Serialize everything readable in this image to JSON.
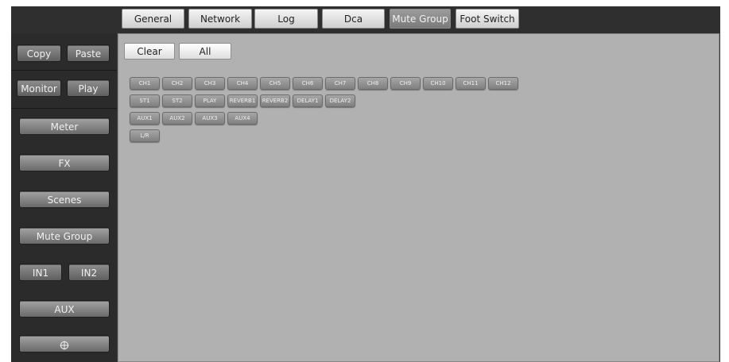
{
  "tabs": [
    {
      "label": "General",
      "active": false
    },
    {
      "label": "Network",
      "active": false
    },
    {
      "label": "Log",
      "active": false
    },
    {
      "label": "Dca",
      "active": false
    },
    {
      "label": "Mute Group",
      "active": true
    },
    {
      "label": "Foot Switch",
      "active": false
    }
  ],
  "sidebar": {
    "copy": "Copy",
    "paste": "Paste",
    "monitor": "Monitor",
    "play": "Play",
    "meter": "Meter",
    "fx": "FX",
    "scenes": "Scenes",
    "mute_group": "Mute Group",
    "in1": "IN1",
    "in2": "IN2",
    "aux": "AUX",
    "bottom_icon": "target-icon"
  },
  "toolbar": {
    "clear": "Clear",
    "all": "All"
  },
  "channels": {
    "row1": [
      "CH1",
      "CH2",
      "CH3",
      "CH4",
      "CH5",
      "CH6",
      "CH7",
      "CH8",
      "CH9",
      "CH10",
      "CH11",
      "CH12"
    ],
    "row2": [
      "ST1",
      "ST2",
      "PLAY",
      "REVERB1",
      "REVERB2",
      "DELAY1",
      "DELAY2"
    ],
    "row3": [
      "AUX1",
      "AUX2",
      "AUX3",
      "AUX4"
    ],
    "row4": [
      "L/R"
    ]
  },
  "colors": {
    "panel_bg": "#b1b1b1",
    "sidebar_bg": "#2b2b2b",
    "active_tab": "#8a8a8a"
  }
}
